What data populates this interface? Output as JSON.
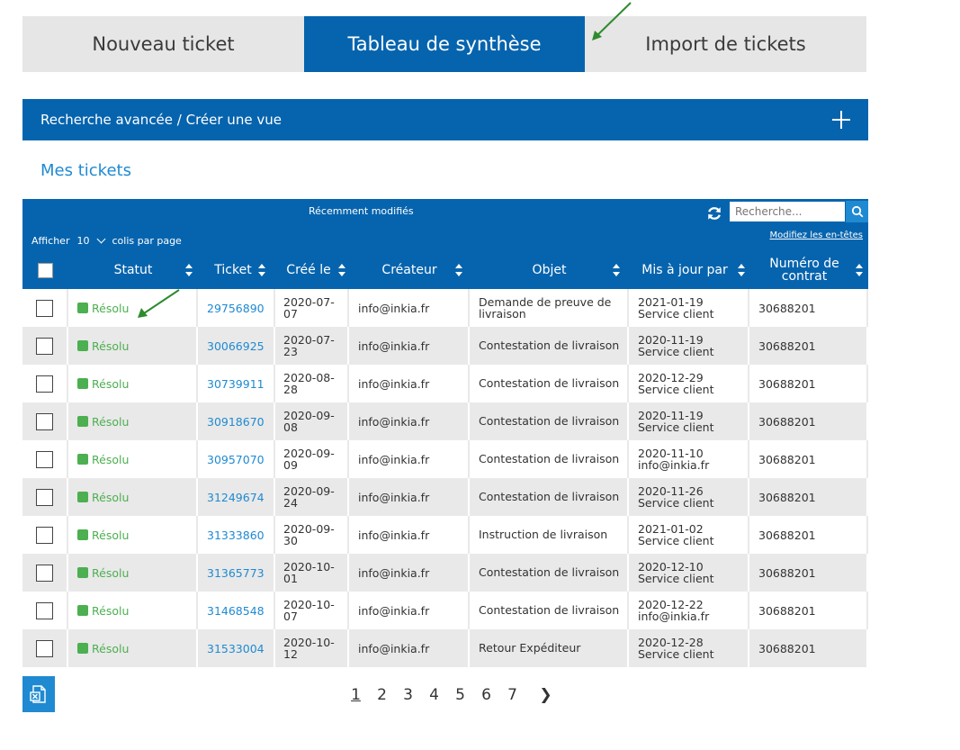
{
  "tabs": [
    {
      "label": "Nouveau ticket"
    },
    {
      "label": "Tableau de synthèse"
    },
    {
      "label": "Import de tickets"
    }
  ],
  "advanced_search": {
    "label": "Recherche avancée / Créer une vue"
  },
  "section_title": "Mes tickets",
  "toolbar": {
    "view_name": "Récemment modifiés",
    "search_placeholder": "Recherche...",
    "modify_headers": "Modifiez les en-têtes",
    "show_label": "Afficher",
    "per_page_value": "10",
    "per_page_suffix": "colis par page"
  },
  "columns": {
    "status": "Statut",
    "ticket": "Ticket",
    "created": "Créé le",
    "creator": "Créateur",
    "subject": "Objet",
    "updated_by": "Mis à jour par",
    "contract": "Numéro de contrat"
  },
  "rows": [
    {
      "status": "Résolu",
      "ticket": "29756890",
      "created": "2020-07-07",
      "creator": "info@inkia.fr",
      "subject": "Demande de preuve de livraison",
      "updated_date": "2021-01-19",
      "updated_by": "Service client",
      "contract": "30688201"
    },
    {
      "status": "Résolu",
      "ticket": "30066925",
      "created": "2020-07-23",
      "creator": "info@inkia.fr",
      "subject": "Contestation de livraison",
      "updated_date": "2020-11-19",
      "updated_by": "Service client",
      "contract": "30688201"
    },
    {
      "status": "Résolu",
      "ticket": "30739911",
      "created": "2020-08-28",
      "creator": "info@inkia.fr",
      "subject": "Contestation de livraison",
      "updated_date": "2020-12-29",
      "updated_by": "Service client",
      "contract": "30688201"
    },
    {
      "status": "Résolu",
      "ticket": "30918670",
      "created": "2020-09-08",
      "creator": "info@inkia.fr",
      "subject": "Contestation de livraison",
      "updated_date": "2020-11-19",
      "updated_by": "Service client",
      "contract": "30688201"
    },
    {
      "status": "Résolu",
      "ticket": "30957070",
      "created": "2020-09-09",
      "creator": "info@inkia.fr",
      "subject": "Contestation de livraison",
      "updated_date": "2020-11-10",
      "updated_by": "info@inkia.fr",
      "contract": "30688201"
    },
    {
      "status": "Résolu",
      "ticket": "31249674",
      "created": "2020-09-24",
      "creator": "info@inkia.fr",
      "subject": "Contestation de livraison",
      "updated_date": "2020-11-26",
      "updated_by": "Service client",
      "contract": "30688201"
    },
    {
      "status": "Résolu",
      "ticket": "31333860",
      "created": "2020-09-30",
      "creator": "info@inkia.fr",
      "subject": "Instruction de livraison",
      "updated_date": "2021-01-02",
      "updated_by": "Service client",
      "contract": "30688201"
    },
    {
      "status": "Résolu",
      "ticket": "31365773",
      "created": "2020-10-01",
      "creator": "info@inkia.fr",
      "subject": "Contestation de livraison",
      "updated_date": "2020-12-10",
      "updated_by": "Service client",
      "contract": "30688201"
    },
    {
      "status": "Résolu",
      "ticket": "31468548",
      "created": "2020-10-07",
      "creator": "info@inkia.fr",
      "subject": "Contestation de livraison",
      "updated_date": "2020-12-22",
      "updated_by": "info@inkia.fr",
      "contract": "30688201"
    },
    {
      "status": "Résolu",
      "ticket": "31533004",
      "created": "2020-10-12",
      "creator": "info@inkia.fr",
      "subject": "Retour Expéditeur",
      "updated_date": "2020-12-28",
      "updated_by": "Service client",
      "contract": "30688201"
    }
  ],
  "pagination": {
    "pages": [
      "1",
      "2",
      "3",
      "4",
      "5",
      "6",
      "7"
    ],
    "current": "1",
    "next": "❯"
  },
  "colors": {
    "primary": "#0664ae",
    "link": "#1f8ad1",
    "status_resolved": "#4caf50",
    "annotation_arrow": "#2e8b2e"
  },
  "icons": {
    "refresh": "refresh-icon",
    "search": "search-icon",
    "add": "plus-icon",
    "export": "excel-export-icon"
  }
}
